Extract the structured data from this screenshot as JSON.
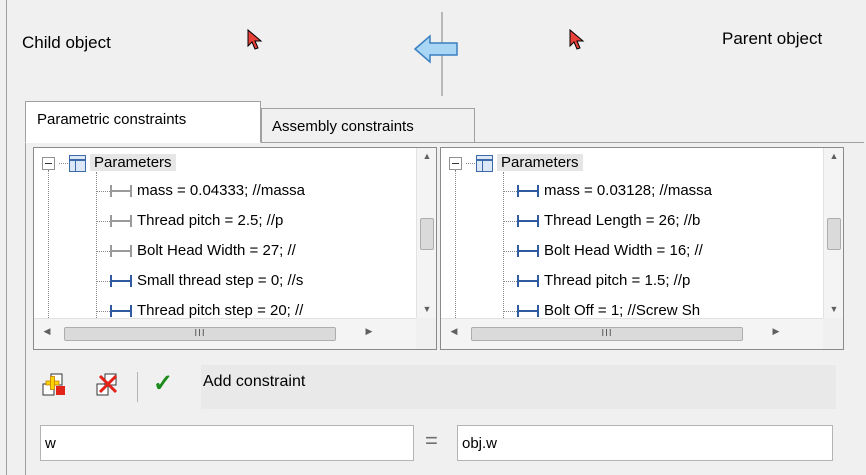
{
  "header": {
    "child_label": "Child object",
    "parent_label": "Parent object"
  },
  "tabs": [
    {
      "label": "Parametric constraints",
      "active": true
    },
    {
      "label": "Assembly constraints",
      "active": false
    }
  ],
  "child_tree": {
    "root": "Parameters",
    "items": [
      {
        "label": "mass = 0.04333; //massa",
        "icon": "grey"
      },
      {
        "label": "Thread pitch = 2.5; //p",
        "icon": "grey"
      },
      {
        "label": "Bolt Head Width = 27; //",
        "icon": "grey"
      },
      {
        "label": "Small thread step = 0; //s",
        "icon": "blue"
      },
      {
        "label": "Thread pitch step = 20; //",
        "icon": "blue"
      }
    ]
  },
  "parent_tree": {
    "root": "Parameters",
    "items": [
      {
        "label": "mass = 0.03128; //massa",
        "icon": "blue"
      },
      {
        "label": "Thread Length = 26; //b",
        "icon": "blue"
      },
      {
        "label": "Bolt Head Width = 16; //",
        "icon": "blue"
      },
      {
        "label": "Thread pitch = 1.5; //p",
        "icon": "blue"
      },
      {
        "label": "Bolt Off = 1; //Screw Sh",
        "icon": "blue"
      }
    ]
  },
  "scroll": {
    "grip": "III"
  },
  "toolbar": {
    "add_icon": "add-constraint-icon",
    "delete_icon": "delete-constraint-icon",
    "apply_icon": "checkmark-icon",
    "status": "Add constraint"
  },
  "equation": {
    "left": "w",
    "operator": "=",
    "right": "obj.w"
  }
}
